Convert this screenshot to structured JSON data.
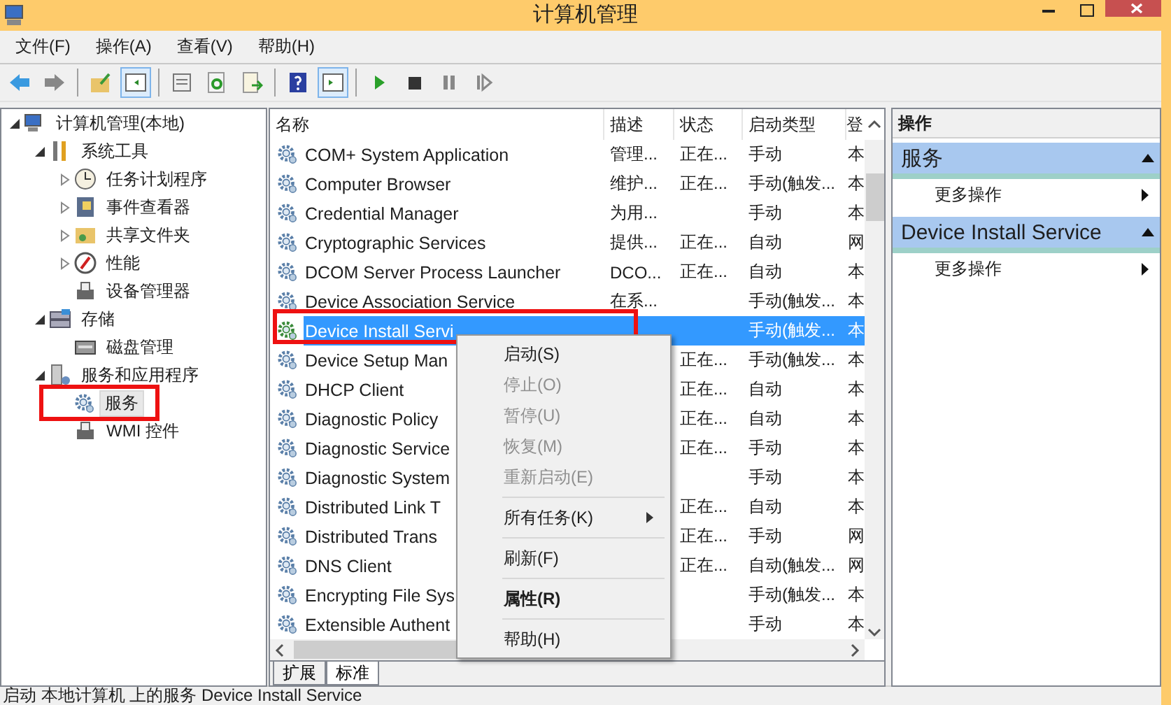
{
  "window": {
    "title": "计算机管理"
  },
  "menu": [
    "文件(F)",
    "操作(A)",
    "查看(V)",
    "帮助(H)"
  ],
  "toolbar": [
    [
      {
        "kind": "back",
        "pressed": false
      },
      {
        "kind": "forward",
        "pressed": false
      }
    ],
    [
      {
        "kind": "up",
        "pressed": false
      },
      {
        "kind": "tree",
        "pressed": true
      }
    ],
    [
      {
        "kind": "props",
        "pressed": false
      },
      {
        "kind": "refresh",
        "pressed": false
      },
      {
        "kind": "export",
        "pressed": false
      }
    ],
    [
      {
        "kind": "help",
        "pressed": false
      },
      {
        "kind": "pane",
        "pressed": true
      }
    ],
    [
      {
        "kind": "play",
        "pressed": false
      },
      {
        "kind": "stop",
        "pressed": false
      },
      {
        "kind": "pause",
        "pressed": false
      },
      {
        "kind": "restart",
        "pressed": false
      }
    ]
  ],
  "tree": [
    {
      "label": "计算机管理(本地)",
      "expanded": true,
      "selected": false,
      "children": [
        {
          "label": "系统工具",
          "expanded": true,
          "selected": false,
          "children": [
            {
              "label": "任务计划程序",
              "expanded": false,
              "selected": false
            },
            {
              "label": "事件查看器",
              "expanded": false,
              "selected": false
            },
            {
              "label": "共享文件夹",
              "expanded": false,
              "selected": false
            },
            {
              "label": "性能",
              "expanded": false,
              "selected": false
            },
            {
              "label": "设备管理器",
              "selected": false
            }
          ]
        },
        {
          "label": "存储",
          "expanded": true,
          "selected": false,
          "children": [
            {
              "label": "磁盘管理",
              "selected": false
            }
          ]
        },
        {
          "label": "服务和应用程序",
          "expanded": true,
          "selected": false,
          "children": [
            {
              "label": "服务",
              "selected": true
            },
            {
              "label": "WMI 控件",
              "selected": false
            }
          ]
        }
      ]
    }
  ],
  "table": {
    "columns": [
      "名称",
      "描述",
      "状态",
      "启动类型",
      "登"
    ],
    "rows": [
      {
        "name": "COM+ System Application",
        "description": "管理...",
        "status": "正在...",
        "startup_type": "手动",
        "column_5": "本",
        "selected": false
      },
      {
        "name": "Computer Browser",
        "description": "维护...",
        "status": "正在...",
        "startup_type": "手动(触发...",
        "column_5": "本",
        "selected": false
      },
      {
        "name": "Credential Manager",
        "description": "为用...",
        "status": "",
        "startup_type": "手动",
        "column_5": "本",
        "selected": false
      },
      {
        "name": "Cryptographic Services",
        "description": "提供...",
        "status": "正在...",
        "startup_type": "自动",
        "column_5": "网",
        "selected": false
      },
      {
        "name": "DCOM Server Process Launcher",
        "description": "DCO...",
        "status": "正在...",
        "startup_type": "自动",
        "column_5": "本",
        "selected": false
      },
      {
        "name": "Device Association Service",
        "description": "在系...",
        "status": "",
        "startup_type": "手动(触发...",
        "column_5": "本",
        "selected": false
      },
      {
        "name": "Device Install Servi",
        "description": "",
        "status": "",
        "startup_type": "手动(触发...",
        "column_5": "本",
        "selected": true
      },
      {
        "name": "Device Setup Man",
        "description": "",
        "status": "正在...",
        "startup_type": "手动(触发...",
        "column_5": "本",
        "selected": false
      },
      {
        "name": "DHCP Client",
        "description": "",
        "status": "正在...",
        "startup_type": "自动",
        "column_5": "本",
        "selected": false
      },
      {
        "name": "Diagnostic Policy",
        "description": "",
        "status": "正在...",
        "startup_type": "自动",
        "column_5": "本",
        "selected": false
      },
      {
        "name": "Diagnostic Service",
        "description": "",
        "status": "正在...",
        "startup_type": "手动",
        "column_5": "本",
        "selected": false
      },
      {
        "name": "Diagnostic System",
        "description": "",
        "status": "",
        "startup_type": "手动",
        "column_5": "本",
        "selected": false
      },
      {
        "name": "Distributed Link T",
        "description": "",
        "status": "正在...",
        "startup_type": "自动",
        "column_5": "本",
        "selected": false
      },
      {
        "name": "Distributed Trans",
        "description": "",
        "status": "正在...",
        "startup_type": "手动",
        "column_5": "网",
        "selected": false
      },
      {
        "name": "DNS Client",
        "description": "",
        "status": "正在...",
        "startup_type": "自动(触发...",
        "column_5": "网",
        "selected": false
      },
      {
        "name": "Encrypting File Sys",
        "description": "",
        "status": "",
        "startup_type": "手动(触发...",
        "column_5": "本",
        "selected": false
      },
      {
        "name": "Extensible Authent",
        "description": "",
        "status": "",
        "startup_type": "手动",
        "column_5": "本",
        "selected": false
      }
    ]
  },
  "view_tabs": [
    {
      "label": "扩展",
      "selected": false
    },
    {
      "label": "标准",
      "selected": true
    }
  ],
  "context_menu": [
    {
      "kind": "item",
      "label": "启动(S)",
      "disabled": false,
      "bold": false,
      "submenu": false
    },
    {
      "kind": "item",
      "label": "停止(O)",
      "disabled": true,
      "bold": false,
      "submenu": false
    },
    {
      "kind": "item",
      "label": "暂停(U)",
      "disabled": true,
      "bold": false,
      "submenu": false
    },
    {
      "kind": "item",
      "label": "恢复(M)",
      "disabled": true,
      "bold": false,
      "submenu": false
    },
    {
      "kind": "item",
      "label": "重新启动(E)",
      "disabled": true,
      "bold": false,
      "submenu": false
    },
    {
      "kind": "separator"
    },
    {
      "kind": "item",
      "label": "所有任务(K)",
      "disabled": false,
      "bold": false,
      "submenu": true
    },
    {
      "kind": "separator"
    },
    {
      "kind": "item",
      "label": "刷新(F)",
      "disabled": false,
      "bold": false,
      "submenu": false
    },
    {
      "kind": "separator"
    },
    {
      "kind": "item",
      "label": "属性(R)",
      "disabled": false,
      "bold": true,
      "submenu": false
    },
    {
      "kind": "separator"
    },
    {
      "kind": "item",
      "label": "帮助(H)",
      "disabled": false,
      "bold": false,
      "submenu": false
    }
  ],
  "actions": {
    "title": "操作",
    "sections": [
      {
        "title": "服务",
        "items": [
          "更多操作"
        ]
      },
      {
        "title": "Device Install Service",
        "items": [
          "更多操作"
        ]
      }
    ]
  },
  "status_bar": "启动 本地计算机 上的服务 Device Install Service"
}
